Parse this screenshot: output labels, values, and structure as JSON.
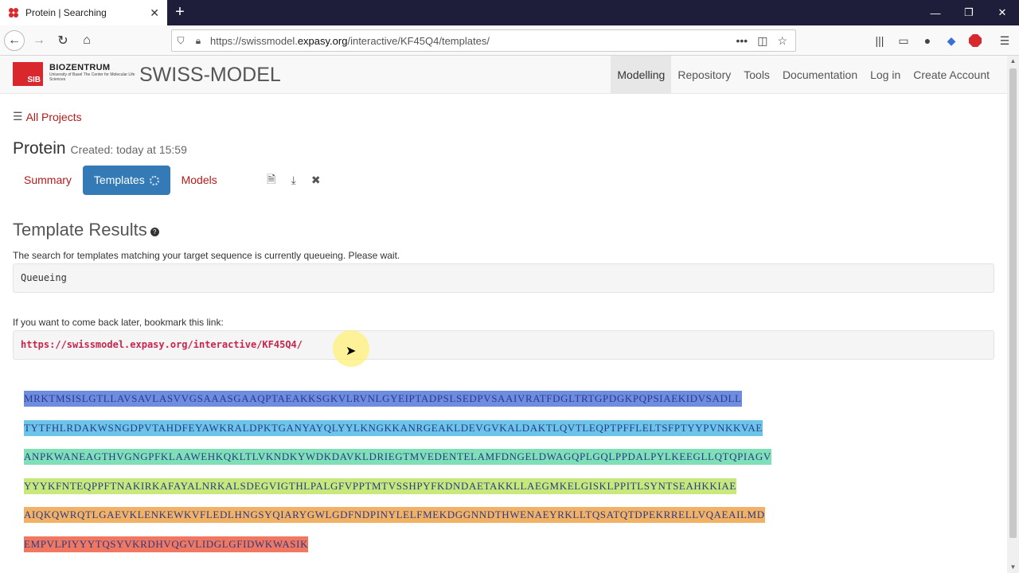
{
  "browser": {
    "tab_title": "Protein | Searching",
    "url_prefix": "https://swissmodel.",
    "url_domain": "expasy.org",
    "url_path": "/interactive/KF45Q4/templates/"
  },
  "header": {
    "sib_label": "SIB",
    "biozentrum_label": "BIOZENTRUM",
    "biozentrum_sub": "University of Basel The Center for Molecular Life Sciences",
    "brand": "SWISS-MODEL",
    "nav": [
      "Modelling",
      "Repository",
      "Tools",
      "Documentation",
      "Log in",
      "Create Account"
    ],
    "nav_active": "Modelling"
  },
  "project": {
    "all_projects": "All Projects",
    "title": "Protein",
    "created": "Created: today at 15:59",
    "tabs": [
      "Summary",
      "Templates",
      "Models"
    ]
  },
  "results": {
    "title": "Template Results",
    "message": "The search for templates matching your target sequence is currently queueing. Please wait.",
    "status": "Queueing",
    "bookmark_msg": "If you want to come back later, bookmark this link:",
    "bookmark_link": "https://swissmodel.expasy.org/interactive/KF45Q4/"
  },
  "sequence": {
    "rows": [
      "MRKTMSISLGTLLAVSAVLASVVGSAAASGAAQPTAEAKKSGKVLRVNLGYEIPTADPSLSEDPVSAAIVRATFDGLTRTGPDGKPQPSIAEKIDVSADLL",
      "TYTFHLRDAKWSNGDPVTAHDFEYAWKRALDPKTGANYAYQLYYLKNGKKANRGEAKLDEVGVKALDAKTLQVTLEQPTPFFLELTSFPTYYPVNKKVAE",
      "ANPKWANEAGTHVGNGPFKLAAWEHKQKLTLVKNDKYWDKDAVKLDRIEGTMVEDENTELAMFDNGELDWAGQPLGQLPPDALPYLKEEGLLQTQPIAGV",
      "YYYKFNTEQPPFTNAKIRKAFAYALNRKALSDEGVIGTHLPALGFVPPTMTVSSHPYFKDNDAETAKKLLAEGMKELGISKLPPITLSYNTSEAHKKIAE",
      "AIQKQWRQTLGAEVKLENKEWKVFLEDLHNGSYQIARYGWLGDFNDPINYLELFMEKDGGNNDTHWENAEYRKLLTQSATQTDPEKRRELLVQAEAILMD",
      "EMPVLPIYYYTQSYVKRDHVQGVLIDGLGFIDWKWASIK"
    ],
    "row_colors": [
      "#6f8de0",
      "#6cc5e8",
      "#7fe0b8",
      "#c7e87a",
      "#f2b266",
      "#f07860"
    ],
    "row_accent": [
      "#5a7ad8",
      "#4fb2e0",
      "#5fd4a0",
      "#b0dc50",
      "#ec9f48",
      "#e9604a"
    ]
  }
}
